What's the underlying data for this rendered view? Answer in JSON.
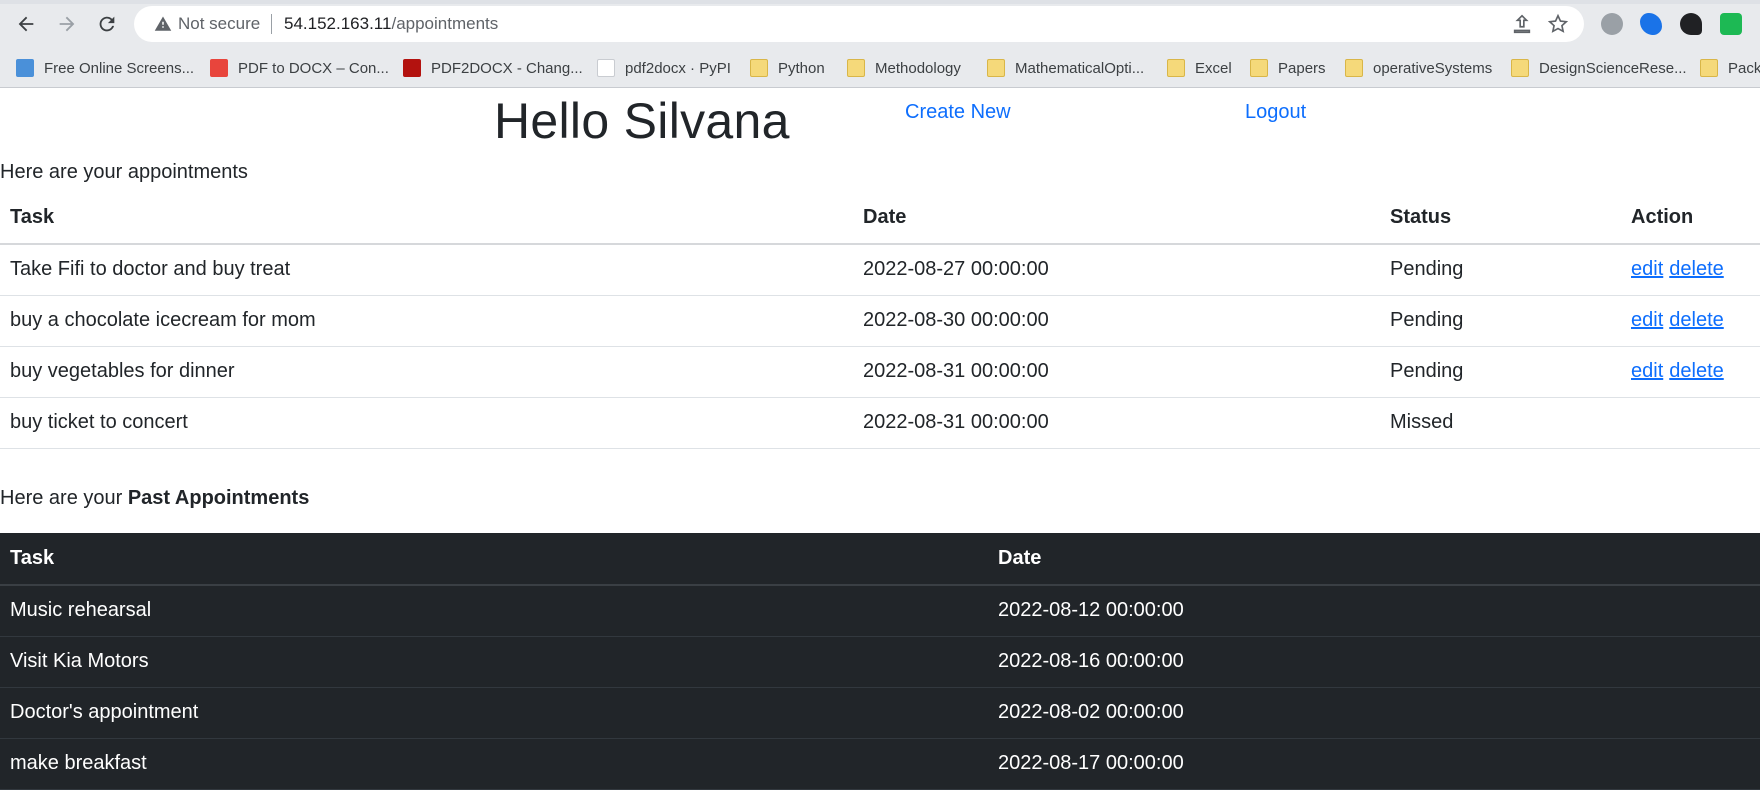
{
  "browser": {
    "not_secure": "Not secure",
    "url_host": "54.152.163.11",
    "url_path": "/appointments",
    "bookmarks": [
      {
        "label": "Free Online Screens...",
        "icon": "screenshot-app-icon"
      },
      {
        "label": "PDF to DOCX – Con...",
        "icon": "pdf-icon"
      },
      {
        "label": "PDF2DOCX - Chang...",
        "icon": "pdf-icon"
      },
      {
        "label": "pdf2docx · PyPI",
        "icon": "pypi-icon"
      },
      {
        "label": "Python",
        "icon": "folder-icon"
      },
      {
        "label": "Methodology",
        "icon": "folder-icon"
      },
      {
        "label": "MathematicalOpti...",
        "icon": "folder-icon"
      },
      {
        "label": "Excel",
        "icon": "folder-icon"
      },
      {
        "label": "Papers",
        "icon": "folder-icon"
      },
      {
        "label": "operativeSystems",
        "icon": "folder-icon"
      },
      {
        "label": "DesignScienceRese...",
        "icon": "folder-icon"
      },
      {
        "label": "Packt",
        "icon": "folder-icon"
      }
    ]
  },
  "header": {
    "greeting": "Hello Silvana",
    "create_new": "Create New",
    "logout": "Logout"
  },
  "appointments": {
    "intro": "Here are your appointments",
    "columns": [
      "Task",
      "Date",
      "Status",
      "Action"
    ],
    "rows": [
      {
        "task": "Take Fifi to doctor and buy treat",
        "date": "2022-08-27 00:00:00",
        "status": "Pending",
        "edit": "edit",
        "delete": "delete"
      },
      {
        "task": "buy a chocolate icecream for mom",
        "date": "2022-08-30 00:00:00",
        "status": "Pending",
        "edit": "edit",
        "delete": "delete"
      },
      {
        "task": "buy vegetables for dinner",
        "date": "2022-08-31 00:00:00",
        "status": "Pending",
        "edit": "edit",
        "delete": "delete"
      },
      {
        "task": "buy ticket to concert",
        "date": "2022-08-31 00:00:00",
        "status": "Missed"
      }
    ]
  },
  "past": {
    "intro_prefix": "Here are your ",
    "intro_bold": "Past Appointments",
    "columns": [
      "Task",
      "Date"
    ],
    "rows": [
      {
        "task": "Music rehearsal",
        "date": "2022-08-12 00:00:00"
      },
      {
        "task": "Visit Kia Motors",
        "date": "2022-08-16 00:00:00"
      },
      {
        "task": "Doctor's appointment",
        "date": "2022-08-02 00:00:00"
      },
      {
        "task": "make breakfast",
        "date": "2022-08-17 00:00:00"
      }
    ]
  },
  "colors": {
    "link": "#0d6efd",
    "dark_table": "#212529",
    "chrome": "#e8eaed"
  }
}
